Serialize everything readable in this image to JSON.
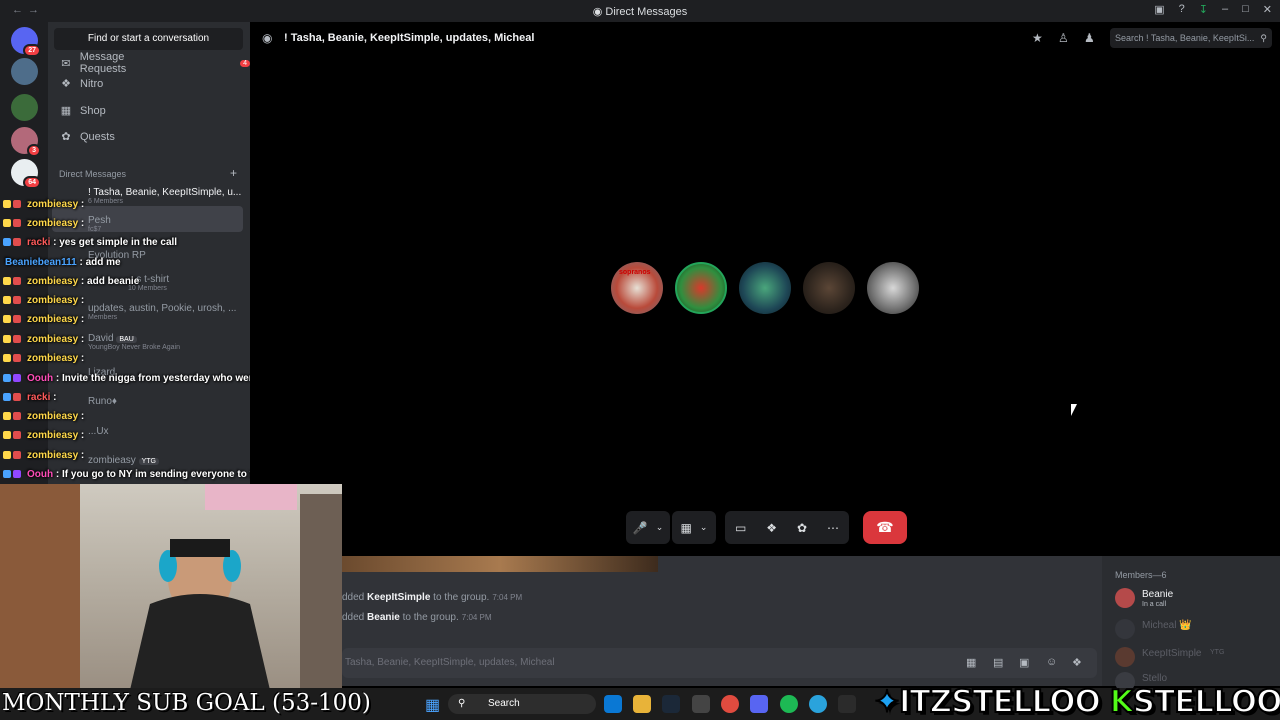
{
  "window": {
    "title": "Direct Messages"
  },
  "sidebar": {
    "find_label": "Find or start a conversation",
    "nav": [
      {
        "label": "Message Requests",
        "badge": "4"
      },
      {
        "label": "Nitro"
      },
      {
        "label": "Shop"
      },
      {
        "label": "Quests"
      }
    ],
    "dm_header": "Direct Messages",
    "dms": [
      {
        "name": "! Tasha, Beanie, KeepItSimple, u...",
        "sub": "6 Members"
      },
      {
        "name": "Pesh",
        "sub": "fc$7"
      },
      {
        "name": "Evolution RP",
        "sub": ""
      },
      {
        "name": "...s t-shirt",
        "sub": "10 Members"
      },
      {
        "name": "updates, austin, Pookie, urosh, ...",
        "sub": "Members"
      },
      {
        "name": "David",
        "tag": "BAU",
        "sub": "YoungBoy Never Broke Again"
      },
      {
        "name": "Lizard",
        "sub": ""
      },
      {
        "name": "Runo♦",
        "sub": ""
      },
      {
        "name": "...Ux",
        "sub": ""
      },
      {
        "name": "zombieasy",
        "tag": "YTG",
        "sub": ""
      }
    ],
    "server_badges": [
      "27",
      "3",
      "64"
    ]
  },
  "stream_chat": [
    {
      "user": "zombieasy",
      "text": ":",
      "color": "orange"
    },
    {
      "user": "zombieasy",
      "text": ":",
      "color": "orange"
    },
    {
      "user": "racki",
      "text": ": yes get simple in the call",
      "color": "red"
    },
    {
      "user": "Beaniebean111",
      "text": ": add me",
      "color": "blue"
    },
    {
      "user": "zombieasy",
      "text": ": add beanie",
      "color": "orange"
    },
    {
      "user": "zombieasy",
      "text": ":",
      "color": "orange"
    },
    {
      "user": "zombieasy",
      "text": ":",
      "color": "orange"
    },
    {
      "user": "zombieasy",
      "text": ":",
      "color": "orange"
    },
    {
      "user": "zombieasy",
      "text": ":",
      "color": "orange"
    },
    {
      "user": "Oouh",
      "text": ": Invite the nigga from yesterday who went off on simple",
      "color": "pink"
    },
    {
      "user": "racki",
      "text": ":",
      "color": "red"
    },
    {
      "user": "zombieasy",
      "text": ":",
      "color": "orange"
    },
    {
      "user": "zombieasy",
      "text": ":",
      "color": "orange"
    },
    {
      "user": "zombieasy",
      "text": ":",
      "color": "orange"
    },
    {
      "user": "Oouh",
      "text": ": If you go to NY im sending everyone to your stream",
      "color": "pink"
    }
  ],
  "header": {
    "dm_title": "! Tasha, Beanie, KeepItSimple, updates, Micheal",
    "search_placeholder": "Search ! Tasha, Beanie, KeepItSi..."
  },
  "call": {
    "avatar_labels": [
      "sopranos",
      "",
      "",
      "",
      ""
    ]
  },
  "messages": [
    {
      "prefix": "dded",
      "name": "KeepItSimple",
      "suffix": "to the group.",
      "time": "7:04 PM"
    },
    {
      "prefix": "dded",
      "name": "Beanie",
      "suffix": "to the group.",
      "time": "7:04 PM"
    }
  ],
  "composer": {
    "placeholder": "Tasha, Beanie, KeepItSimple, updates, Micheal"
  },
  "members": {
    "header": "Members—6",
    "list": [
      {
        "name": "Beanie",
        "status": "In a call",
        "color": "#f2f3f5"
      },
      {
        "name": "Micheal 👑",
        "status": "",
        "color": "#5c5e66"
      },
      {
        "name": "KeepItSimple",
        "tag": "YTG",
        "status": "",
        "color": "#5c5e66"
      },
      {
        "name": "Stello",
        "status": "",
        "color": "#5c5e66"
      }
    ]
  },
  "overlay": {
    "sub_goal": "MONTHLY SUB GOAL (53-100)",
    "twitter": "ITZSTELLOO",
    "kick": "STELLOOO"
  },
  "taskbar": {
    "search_label": "Search"
  },
  "colors": {
    "accent": "#5865f2",
    "danger": "#da373c",
    "bg": "#000000",
    "sidebar": "#2b2d31"
  }
}
